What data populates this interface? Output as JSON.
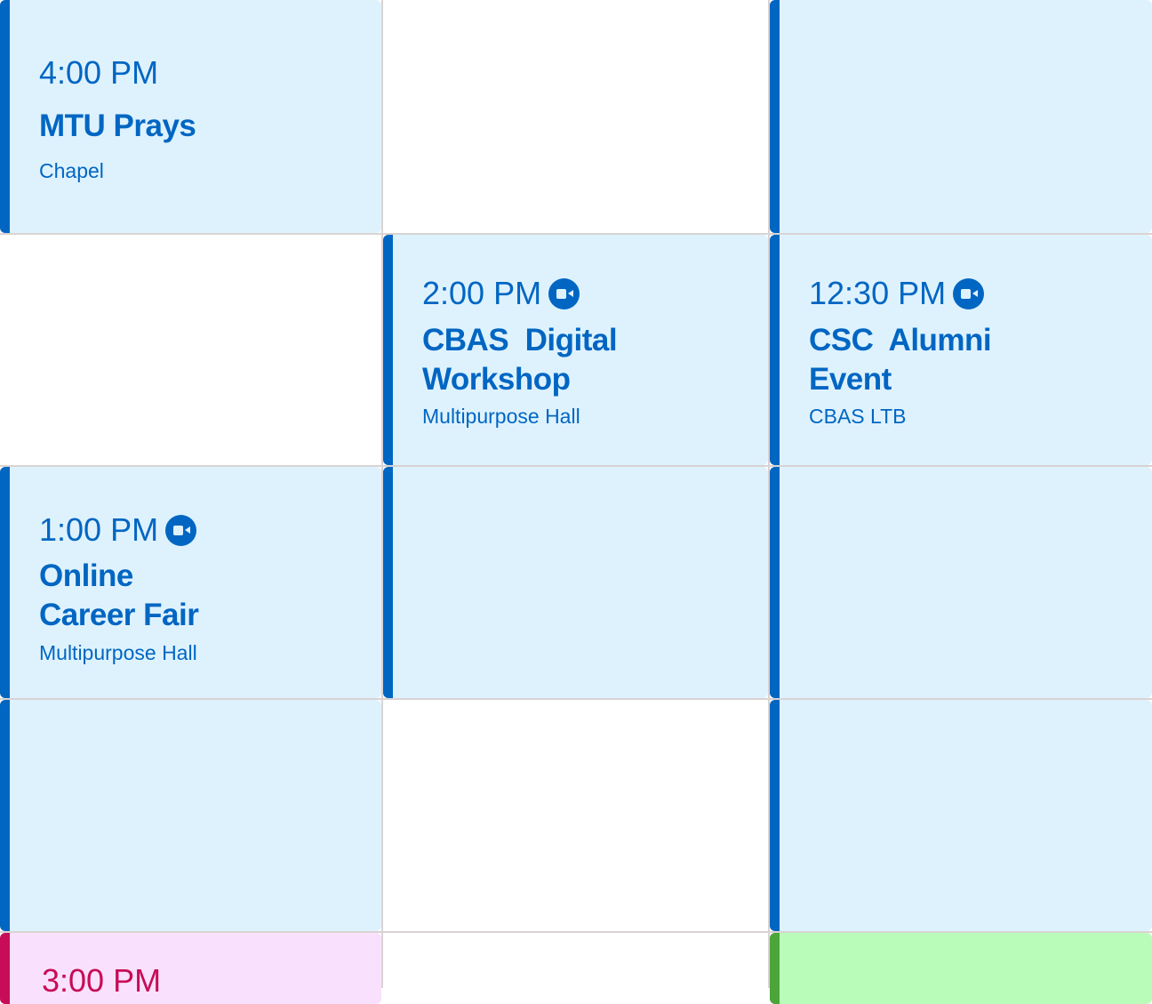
{
  "events": [
    {
      "time": "4:00 PM",
      "title_lines": [
        "MTU Prays"
      ],
      "location": "Chapel",
      "online": false
    },
    {
      "time": "2:00 PM",
      "title_lines": [
        "CBAS  Digital",
        "Workshop"
      ],
      "location": "Multipurpose Hall",
      "online": true
    },
    {
      "time": "12:30 PM",
      "title_lines": [
        "CSC  Alumni",
        "Event"
      ],
      "location": "CBAS LTB",
      "online": true
    },
    {
      "time": "1:00 PM",
      "title_lines": [
        "Online",
        "Career Fair"
      ],
      "location": "Multipurpose Hall",
      "online": true
    },
    {
      "time": "3:00 PM",
      "title_lines": [],
      "location": "",
      "online": false
    }
  ],
  "colors": {
    "blue_accent": "#0066c2",
    "blue_bg": "#def2fe",
    "pink_accent": "#c70d57",
    "pink_bg": "#f9e1fd",
    "green_accent": "#4ca538",
    "green_bg": "#b9fcb9",
    "gridline": "#d9d3d3"
  },
  "icons": {
    "online": "video-camera-icon"
  }
}
